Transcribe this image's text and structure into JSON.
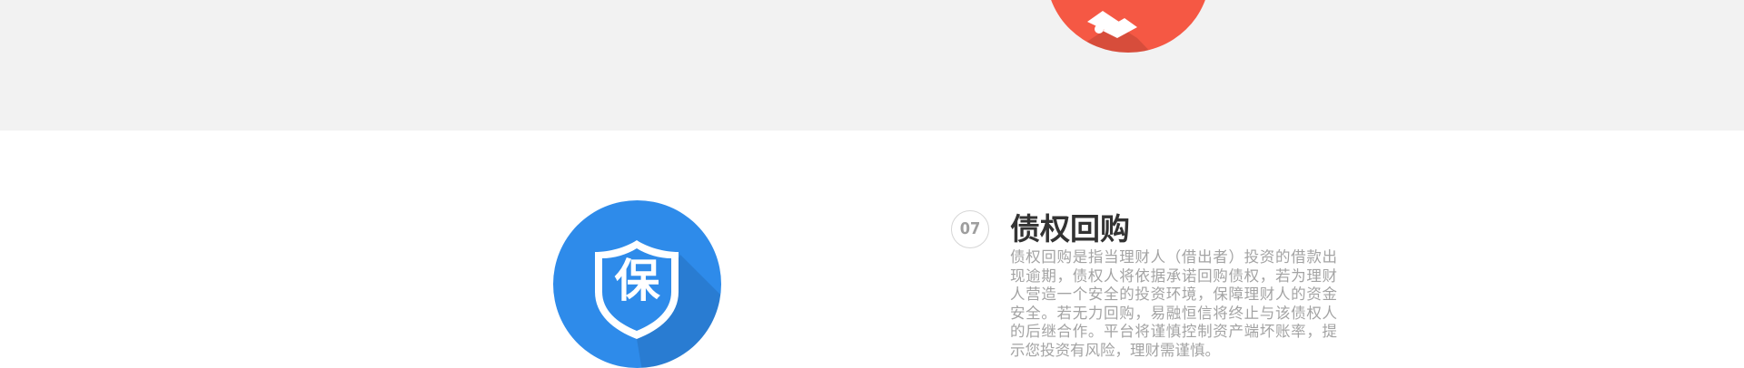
{
  "top_section": {
    "icon": "hand-icon",
    "icon_color": "#f55844",
    "background": "#f2f2f2"
  },
  "feature": {
    "icon": "shield-icon",
    "icon_color": "#2e8bea",
    "icon_char": "保",
    "number": "07",
    "title": "债权回购",
    "description": "债权回购是指当理财人（借出者）投资的借款出现逾期，债权人将依据承诺回购债权，若为理财人营造一个安全的投资环境，保障理财人的资金安全。若无力回购，易融恒信将终止与该债权人的后继合作。平台将谨慎控制资产端坏账率，提示您投资有风险，理财需谨慎。"
  }
}
